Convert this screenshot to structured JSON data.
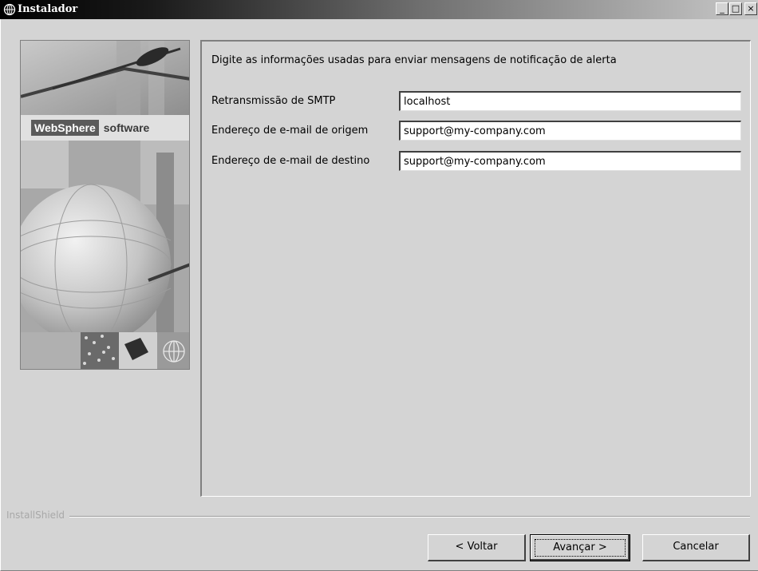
{
  "window": {
    "title": "Instalador",
    "icon": "globe-icon",
    "minimize": "_",
    "maximize": "□",
    "close": "×"
  },
  "branding": {
    "websphere": "WebSphere",
    "software": "software"
  },
  "form": {
    "heading": "Digite as informações usadas para enviar mensagens de notificação de alerta",
    "fields": [
      {
        "label": "Retransmissão de SMTP",
        "value": "localhost"
      },
      {
        "label": "Endereço de e-mail de origem",
        "value": "support@my-company.com"
      },
      {
        "label": "Endereço de e-mail de destino",
        "value": "support@my-company.com"
      }
    ]
  },
  "footer": {
    "installshield": "InstallShield"
  },
  "buttons": {
    "back": "< Voltar",
    "next": "Avançar >",
    "cancel": "Cancelar"
  }
}
